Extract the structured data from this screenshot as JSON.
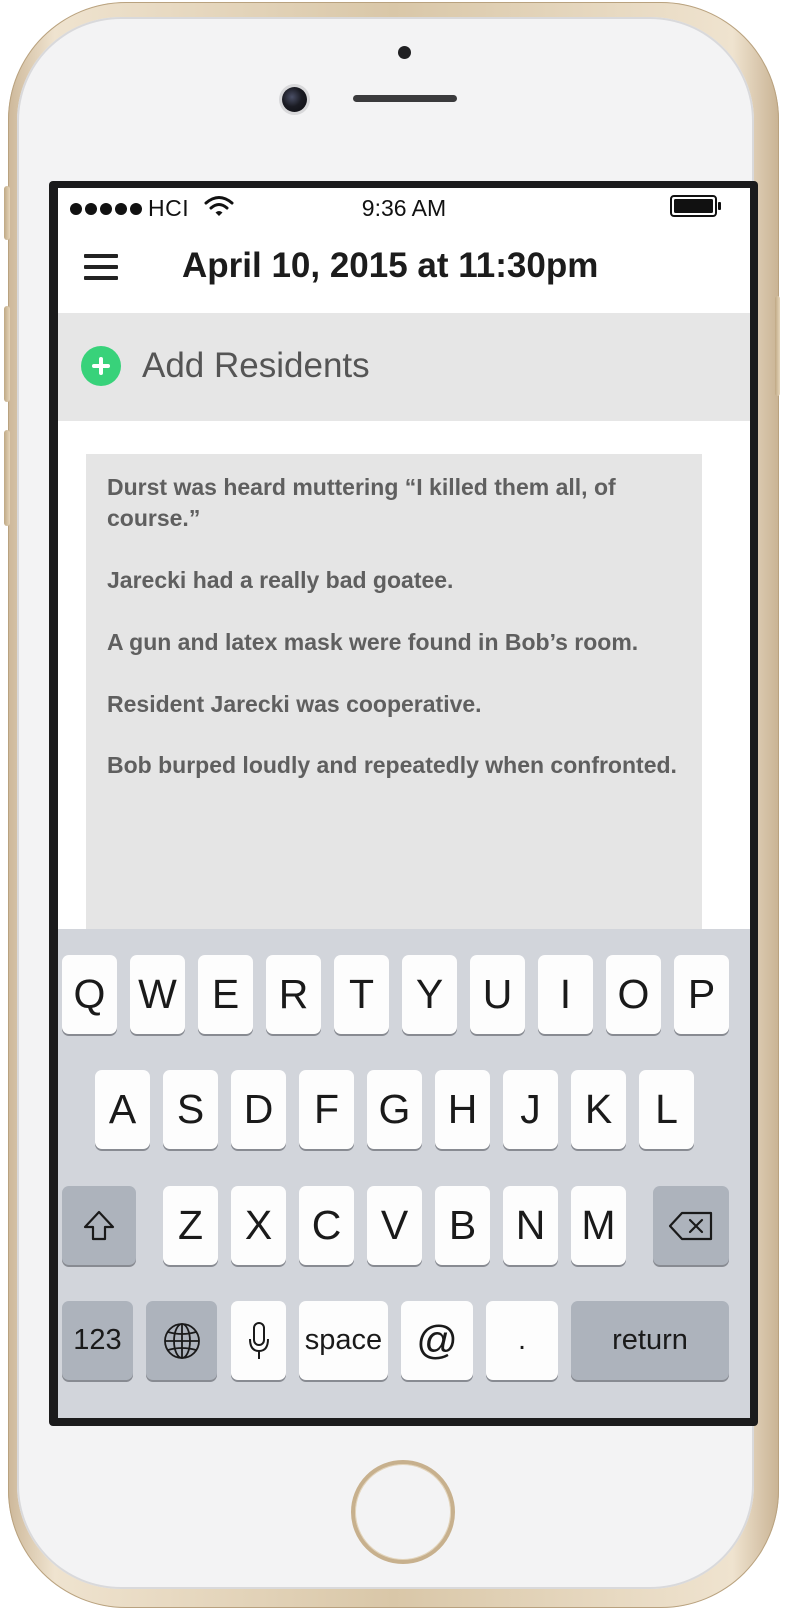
{
  "status_bar": {
    "carrier": "HCI",
    "time": "9:36 AM"
  },
  "nav": {
    "title": "April 10, 2015 at 11:30pm",
    "menu_icon": "hamburger-menu-icon"
  },
  "add_residents": {
    "label": "Add Residents",
    "icon": "plus-circle-icon",
    "icon_color": "#38d27a"
  },
  "notes": [
    "Durst was heard muttering “I killed them all, of course.”",
    "Jarecki had a really bad goatee.",
    "A gun and latex mask were found in Bob’s room.",
    "Resident Jarecki was cooperative.",
    "Bob burped loudly and repeatedly when confronted."
  ],
  "keyboard": {
    "row1": [
      "Q",
      "W",
      "E",
      "R",
      "T",
      "Y",
      "U",
      "I",
      "O",
      "P"
    ],
    "row2": [
      "A",
      "S",
      "D",
      "F",
      "G",
      "H",
      "J",
      "K",
      "L"
    ],
    "row3": [
      "Z",
      "X",
      "C",
      "V",
      "B",
      "N",
      "M"
    ],
    "bottom": {
      "numbers": "123",
      "space": "space",
      "at": "@",
      "period": ".",
      "return": "return"
    },
    "icons": [
      "shift-icon",
      "backspace-icon",
      "globe-icon",
      "microphone-icon"
    ]
  }
}
